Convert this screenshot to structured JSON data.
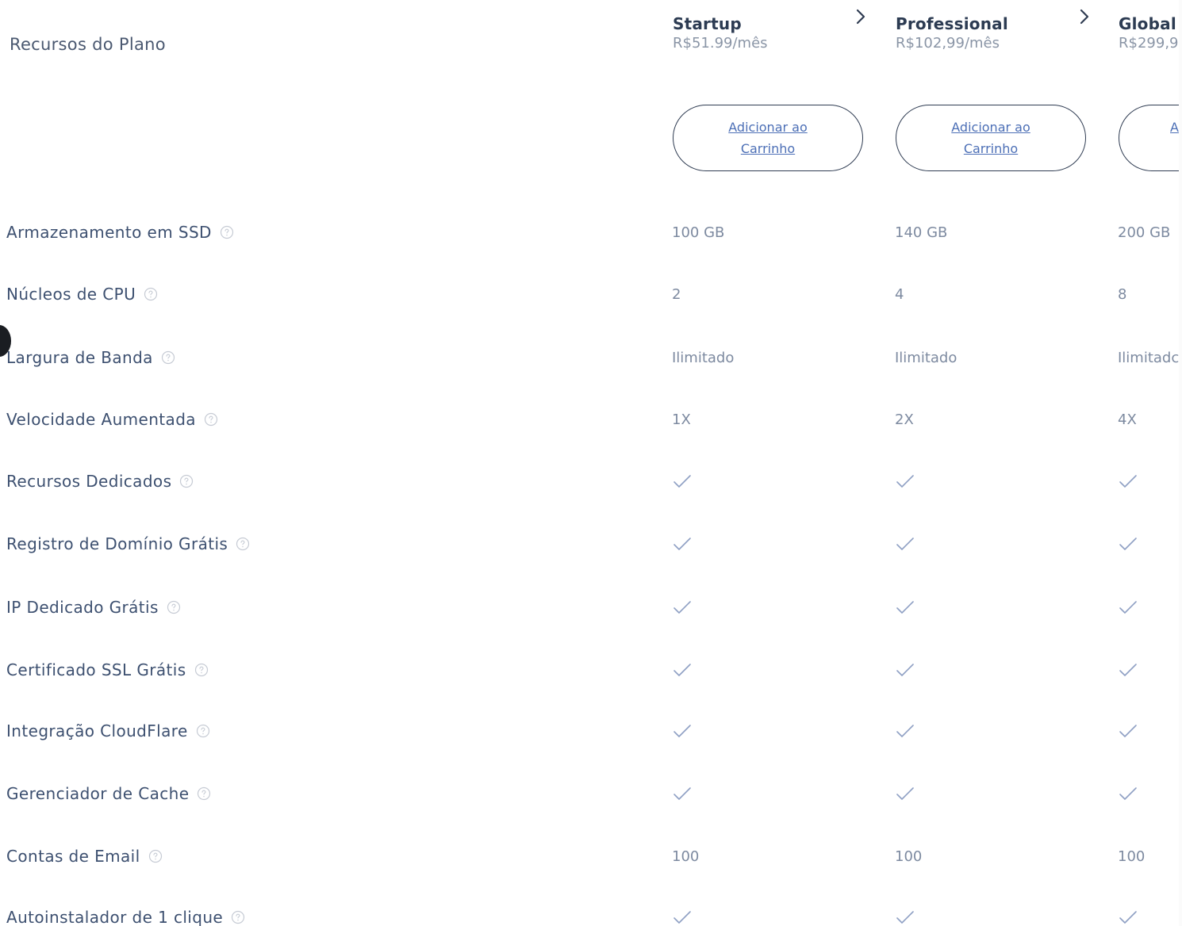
{
  "header": {
    "title": "Recursos do Plano"
  },
  "plans": [
    {
      "name": "Startup",
      "price": "R$51.99/mês",
      "cart_label": "Adicionar ao Carrinho"
    },
    {
      "name": "Professional",
      "price": "R$102,99/mês",
      "cart_label": "Adicionar ao Carrinho"
    },
    {
      "name": "Global",
      "price": "R$299,9",
      "cart_label": "A"
    }
  ],
  "features": [
    {
      "label": "Armazenamento em SSD",
      "values": [
        "100 GB",
        "140 GB",
        "200 GB"
      ]
    },
    {
      "label": "Núcleos de CPU",
      "values": [
        "2",
        "4",
        "8"
      ]
    },
    {
      "label": "Largura de Banda",
      "values": [
        "Ilimitado",
        "Ilimitado",
        "Ilimitadc"
      ]
    },
    {
      "label": "Velocidade Aumentada",
      "values": [
        "1X",
        "2X",
        "4X"
      ]
    },
    {
      "label": "Recursos Dedicados",
      "values": [
        "check",
        "check",
        "check"
      ]
    },
    {
      "label": "Registro de Domínio Grátis",
      "values": [
        "check",
        "check",
        "check"
      ]
    },
    {
      "label": "IP Dedicado Grátis",
      "values": [
        "check",
        "check",
        "check"
      ]
    },
    {
      "label": "Certificado SSL Grátis",
      "values": [
        "check",
        "check",
        "check"
      ]
    },
    {
      "label": "Integração CloudFlare",
      "values": [
        "check",
        "check",
        "check"
      ]
    },
    {
      "label": "Gerenciador de Cache",
      "values": [
        "check",
        "check",
        "check"
      ]
    },
    {
      "label": "Contas de Email",
      "values": [
        "100",
        "100",
        "100"
      ]
    },
    {
      "label": "Autoinstalador de 1 clique",
      "values": [
        "check",
        "check",
        "check"
      ]
    }
  ],
  "icons": {
    "help": "question-circle-icon",
    "included": "check-icon",
    "next": "chevron-right-icon"
  },
  "colors": {
    "button_border": "#2f3c52",
    "button_text": "#4c6fb6",
    "check": "#8fa0c4"
  }
}
